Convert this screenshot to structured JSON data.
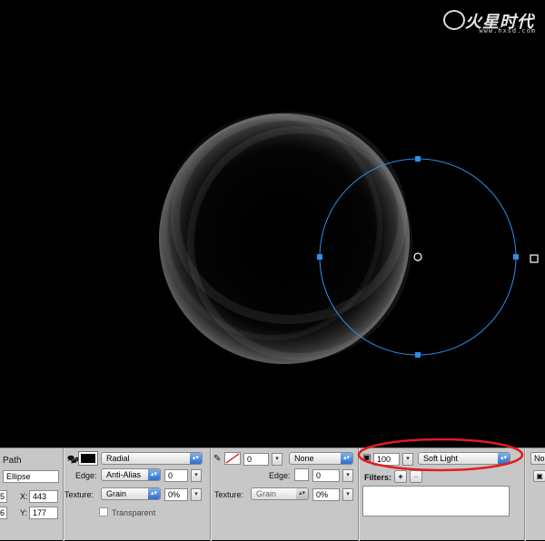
{
  "watermark": {
    "brand": "火星时代",
    "url": "www.hxsd.com"
  },
  "properties_panel": {
    "object": {
      "title": "Path",
      "name_value": "Ellipse",
      "w_value": "5",
      "h_value": "6",
      "x_label": "X:",
      "x_value": "443",
      "y_label": "Y:",
      "y_value": "177"
    },
    "fill": {
      "type": "Radial",
      "edge_label": "Edge:",
      "edge_value": "Anti-Alias",
      "edge_amount": "0",
      "texture_label": "Texture:",
      "texture_value": "Grain",
      "texture_amount": "0%",
      "transparent_label": "Transparent"
    },
    "stroke": {
      "size": "0",
      "type": "None",
      "edge_label": "Edge:",
      "edge_amount": "0",
      "texture_label": "Texture:",
      "texture_value": "Grain",
      "texture_amount": "0%"
    },
    "blend": {
      "opacity": "100",
      "mode": "Soft Light",
      "filters_label": "Filters:",
      "add_filter": "+",
      "remove_filter": "−"
    },
    "right_edge": {
      "button_label": "No"
    }
  },
  "colors": {
    "selection_blue": "#2f8ee8",
    "highlight_ellipse": "#e31b1b",
    "panel_bg": "#c7c7c7"
  }
}
